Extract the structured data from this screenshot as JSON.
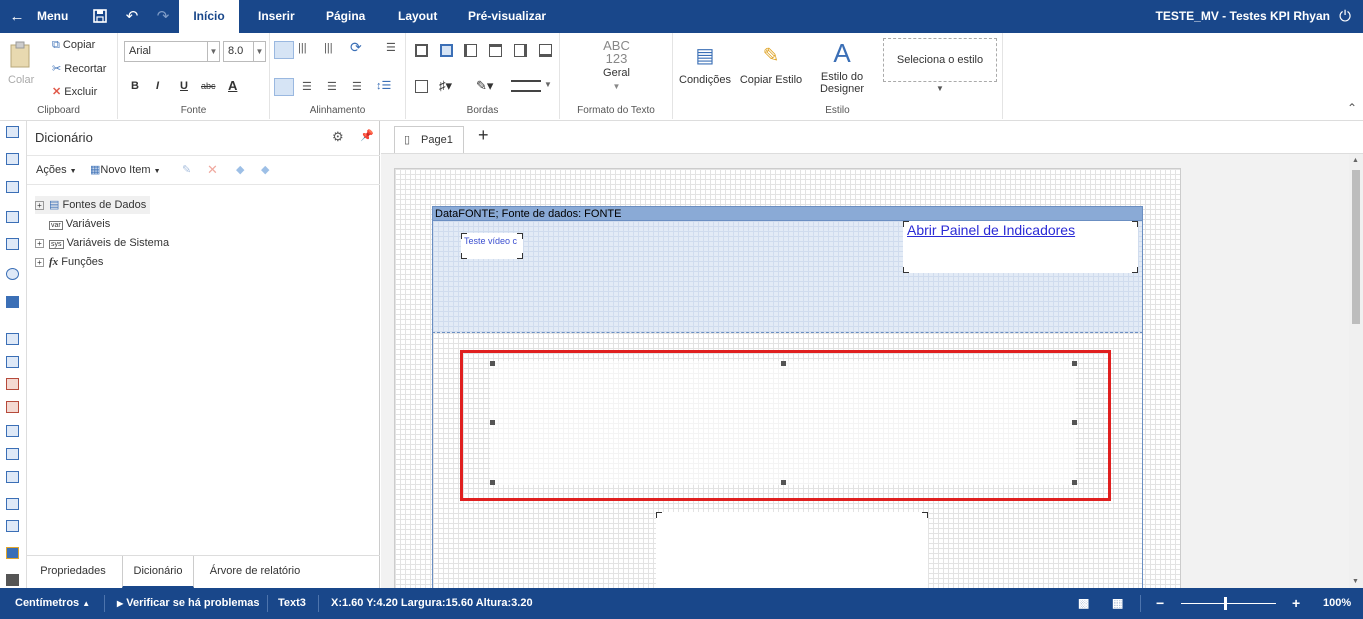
{
  "topbar": {
    "menu_label": "Menu",
    "tabs": [
      {
        "label": "Início",
        "active": true
      },
      {
        "label": "Inserir"
      },
      {
        "label": "Página"
      },
      {
        "label": "Layout"
      },
      {
        "label": "Pré-visualizar"
      }
    ],
    "report_title": "TESTE_MV - Testes KPI Rhyan"
  },
  "ribbon": {
    "clipboard": {
      "paste": "Colar",
      "copy": "Copiar",
      "cut": "Recortar",
      "delete": "Excluir",
      "label": "Clipboard"
    },
    "font": {
      "family": "Arial",
      "size": "8.0",
      "bold": "B",
      "italic": "I",
      "underline": "U",
      "strike": "abc",
      "color": "A",
      "label": "Fonte"
    },
    "alignment": {
      "label": "Alinhamento"
    },
    "borders": {
      "label": "Bordas"
    },
    "text_format": {
      "abc": "ABC",
      "num": "123",
      "general": "Geral",
      "label": "Formato do Texto"
    },
    "style": {
      "conditions": "Condições",
      "copy_style": "Copiar Estilo",
      "designer_style_1": "Estilo do",
      "designer_style_2": "Designer",
      "select_style": "Seleciona o estilo",
      "label": "Estilo"
    }
  },
  "dictionary": {
    "title": "Dicionário",
    "actions": "Ações",
    "new_item": "Novo Item",
    "tree": [
      {
        "label": "Fontes de Dados",
        "expandable": true
      },
      {
        "label": "Variáveis",
        "expandable": false
      },
      {
        "label": "Variáveis de Sistema",
        "expandable": true
      },
      {
        "label": "Funções",
        "expandable": true
      }
    ],
    "bottom_tabs": [
      {
        "label": "Propriedades"
      },
      {
        "label": "Dicionário",
        "active": true
      },
      {
        "label": "Árvore de relatório"
      }
    ]
  },
  "canvas": {
    "page_tab": "Page1",
    "add_page": "+",
    "band_header": "DataFONTE; Fonte de dados: FONTE",
    "text_small": "Teste vídeo c",
    "link_text": "Abrir Painel de Indicadores",
    "selection_color": "#e02020"
  },
  "statusbar": {
    "units": "Centímetros",
    "check": "Verificar se há problemas",
    "component": "Text3",
    "coords": "X:1.60 Y:4.20 Largura:15.60 Altura:3.20",
    "zoom_minus": "−",
    "zoom_plus": "+",
    "zoom": "100%",
    "zoom_fraction": 0.45
  }
}
